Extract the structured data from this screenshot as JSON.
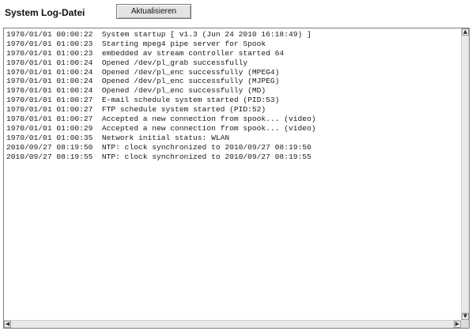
{
  "header": {
    "title": "System Log-Datei",
    "refresh_label": "Aktualisieren"
  },
  "log": {
    "lines": [
      "1970/01/01 00:00:22  System startup [ v1.3 (Jun 24 2010 16:18:49) ]",
      "1970/01/01 01:00:23  Starting mpeg4 pipe server for Spook",
      "1970/01/01 01:00:23  embedded av stream controller started 64",
      "1970/01/01 01:00:24  Opened /dev/pl_grab successfully",
      "1970/01/01 01:00:24  Opened /dev/pl_enc successfully (MPEG4)",
      "1970/01/01 01:00:24  Opened /dev/pl_enc successfully (MJPEG)",
      "1970/01/01 01:00:24  Opened /dev/pl_enc successfully (MD)",
      "1970/01/01 01:00:27  E-mail schedule system started (PID:53)",
      "1970/01/01 01:00:27  FTP schedule system started (PID:52)",
      "1970/01/01 01:00:27  Accepted a new connection from spook... (video)",
      "1970/01/01 01:00:29  Accepted a new connection from spook... (video)",
      "1970/01/01 01:00:35  Network initial status: WLAN",
      "2010/09/27 08:19:50  NTP: clock synchronized to 2010/09/27 08:19:50",
      "2010/09/27 08:19:55  NTP: clock synchronized to 2010/09/27 08:19:55"
    ]
  },
  "scrollbar": {
    "up_glyph": "▲",
    "down_glyph": "▼",
    "left_glyph": "◀",
    "right_glyph": "▶"
  }
}
